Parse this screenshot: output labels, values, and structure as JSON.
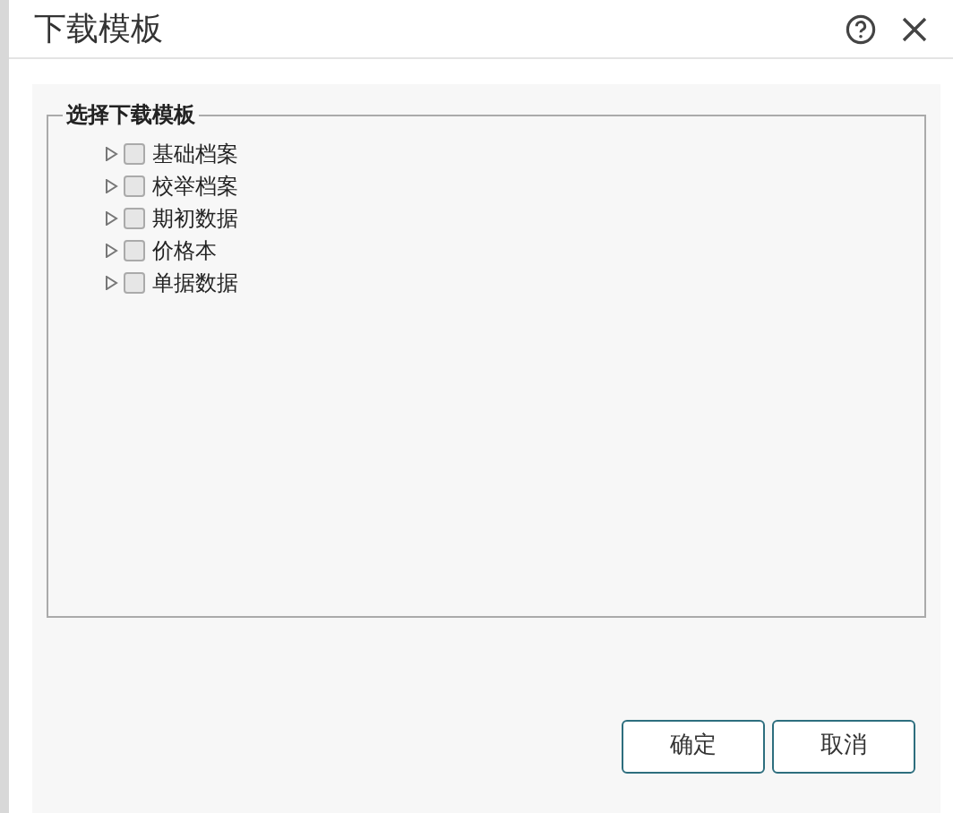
{
  "window": {
    "title": "下载模板"
  },
  "group": {
    "legend": "选择下载模板",
    "items": [
      {
        "label": "基础档案",
        "checked": false,
        "expanded": false
      },
      {
        "label": "校举档案",
        "checked": false,
        "expanded": false
      },
      {
        "label": "期初数据",
        "checked": false,
        "expanded": false
      },
      {
        "label": "价格本",
        "checked": false,
        "expanded": false
      },
      {
        "label": "单据数据",
        "checked": false,
        "expanded": false
      }
    ]
  },
  "buttons": [
    "确定",
    "取消"
  ]
}
